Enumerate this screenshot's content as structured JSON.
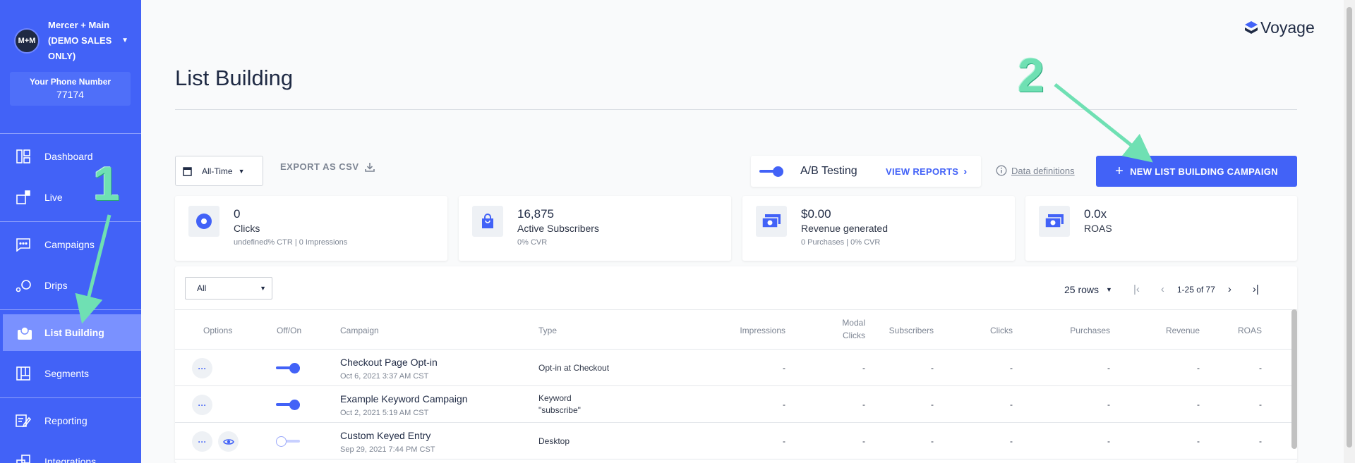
{
  "account": {
    "initials": "M+M",
    "name": "Mercer + Main (DEMO SALES ONLY)"
  },
  "phone": {
    "label": "Your Phone Number",
    "number": "77174"
  },
  "nav": {
    "dashboard": "Dashboard",
    "live": "Live",
    "campaigns": "Campaigns",
    "drips": "Drips",
    "list_building": "List Building",
    "segments": "Segments",
    "reporting": "Reporting",
    "integrations": "Integrations"
  },
  "brand": {
    "logo_text": "Voyage",
    "accent": "#4262f7"
  },
  "page": {
    "title": "List Building"
  },
  "toolbar": {
    "date_range": "All-Time",
    "export_label": "EXPORT AS CSV",
    "ab_label": "A/B Testing",
    "ab_enabled": true,
    "view_reports": "VIEW REPORTS",
    "data_definitions": "Data definitions",
    "new_campaign": "NEW LIST BUILDING CAMPAIGN"
  },
  "stats": [
    {
      "value": "0",
      "label": "Clicks",
      "sub": "undefined% CTR | 0 Impressions",
      "icon": "target-icon"
    },
    {
      "value": "16,875",
      "label": "Active Subscribers",
      "sub": "0% CVR",
      "icon": "shopping-bag-icon"
    },
    {
      "value": "$0.00",
      "label": "Revenue generated",
      "sub": "0 Purchases | 0% CVR",
      "icon": "cash-icon"
    },
    {
      "value": "0.0x",
      "label": "ROAS",
      "sub": "",
      "icon": "cash-icon"
    }
  ],
  "table": {
    "filter": "All",
    "rows_per_page": "25 rows",
    "range": "1-25 of 77",
    "headers": {
      "options": "Options",
      "onoff": "Off/On",
      "campaign": "Campaign",
      "type": "Type",
      "impressions": "Impressions",
      "modal_clicks_1": "Modal",
      "modal_clicks_2": "Clicks",
      "subscribers": "Subscribers",
      "clicks": "Clicks",
      "purchases": "Purchases",
      "revenue": "Revenue",
      "roas": "ROAS"
    },
    "rows": [
      {
        "name": "Checkout Page Opt-in",
        "date": "Oct 6, 2021 3:37 AM CST",
        "type_1": "Opt-in at Checkout",
        "type_2": "",
        "on": true,
        "impressions": "-",
        "modal_clicks": "-",
        "subscribers": "-",
        "clicks": "-",
        "purchases": "-",
        "revenue": "-",
        "roas": "-"
      },
      {
        "name": "Example Keyword Campaign",
        "date": "Oct 2, 2021 5:19 AM CST",
        "type_1": "Keyword",
        "type_2": "\"subscribe\"",
        "on": true,
        "impressions": "-",
        "modal_clicks": "-",
        "subscribers": "-",
        "clicks": "-",
        "purchases": "-",
        "revenue": "-",
        "roas": "-"
      },
      {
        "name": "Custom Keyed Entry",
        "date": "Sep 29, 2021 7:44 PM CST",
        "type_1": "Desktop",
        "type_2": "",
        "on": false,
        "impressions": "-",
        "modal_clicks": "-",
        "subscribers": "-",
        "clicks": "-",
        "purchases": "-",
        "revenue": "-",
        "roas": "-"
      }
    ]
  },
  "annotations": {
    "step1": "1",
    "step2": "2",
    "color": "#6fe0b3"
  }
}
